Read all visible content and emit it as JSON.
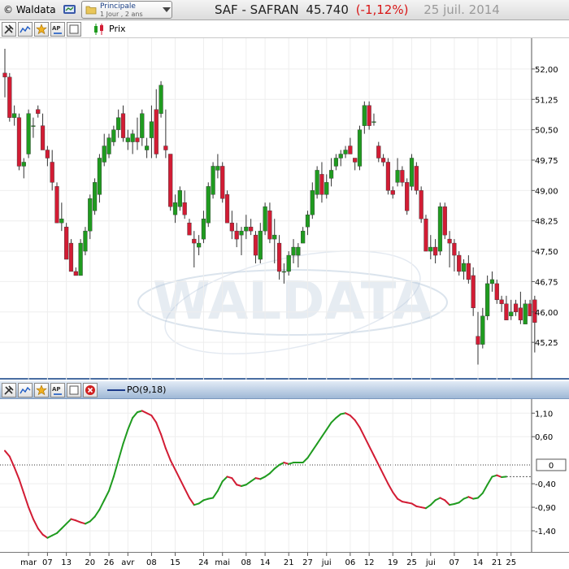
{
  "window": {
    "app_name": "© Waldata",
    "layout": {
      "name": "Principale",
      "period": "1 Jour , 2 ans"
    },
    "symbol": {
      "ticker": "SAF - SAFRAN",
      "price": "45.740",
      "change": "(-1,12%)",
      "date": "25 juil. 2014"
    }
  },
  "price_panel": {
    "legend": "Prix"
  },
  "osc_panel": {
    "legend": "PO(9,18)",
    "current_value_label": "0"
  },
  "icons": {
    "toolbar": [
      "tools-icon",
      "line-chart-icon",
      "star-tools-icon",
      "text-annotation-icon",
      "blank-square-icon",
      "close-icon"
    ],
    "title": [
      "layout-icon",
      "folder-icon",
      "chevron-down-icon"
    ]
  },
  "colors": {
    "up": "#1f9b1f",
    "down": "#d21c34",
    "watermark": "#b8c9dc",
    "panel_border": "#4a6ea2"
  },
  "chart_data": [
    {
      "type": "candlestick",
      "title": "SAF - SAFRAN",
      "legend": "Prix",
      "ylim": [
        44.45,
        52.6
      ],
      "yticks": [
        "52,00",
        "51,25",
        "50,50",
        "49,75",
        "49,00",
        "48,25",
        "47,50",
        "46,75",
        "46,00",
        "45,25"
      ],
      "x_labels": [
        "mar",
        "07",
        "13",
        "20",
        "26",
        "avr",
        "08",
        "15",
        "24",
        "mai",
        "08",
        "14",
        "21",
        "27",
        "jui",
        "06",
        "12",
        "19",
        "25",
        "jui",
        "07",
        "14",
        "21",
        "25"
      ],
      "x_label_index": [
        5,
        9,
        13,
        18,
        22,
        26,
        31,
        36,
        42,
        46,
        51,
        55,
        60,
        64,
        68,
        73,
        77,
        82,
        86,
        90,
        95,
        100,
        104,
        107
      ],
      "candles": [
        {
          "o": 51.9,
          "h": 52.5,
          "l": 51.3,
          "c": 51.8
        },
        {
          "o": 51.8,
          "h": 51.9,
          "l": 50.7,
          "c": 50.8
        },
        {
          "o": 50.8,
          "h": 51.1,
          "l": 50.6,
          "c": 50.9
        },
        {
          "o": 50.8,
          "h": 50.9,
          "l": 49.5,
          "c": 49.6
        },
        {
          "o": 49.6,
          "h": 49.8,
          "l": 49.3,
          "c": 49.7
        },
        {
          "o": 49.9,
          "h": 51.0,
          "l": 49.8,
          "c": 50.9
        },
        {
          "o": 50.6,
          "h": 50.8,
          "l": 50.3,
          "c": 50.6
        },
        {
          "o": 51.0,
          "h": 51.1,
          "l": 50.8,
          "c": 50.9
        },
        {
          "o": 50.6,
          "h": 50.9,
          "l": 50.0,
          "c": 50.0
        },
        {
          "o": 50.0,
          "h": 50.1,
          "l": 49.6,
          "c": 49.8
        },
        {
          "o": 49.7,
          "h": 50.0,
          "l": 49.0,
          "c": 49.2
        },
        {
          "o": 49.1,
          "h": 49.2,
          "l": 48.2,
          "c": 48.2
        },
        {
          "o": 48.2,
          "h": 48.7,
          "l": 48.0,
          "c": 48.3
        },
        {
          "o": 48.1,
          "h": 48.2,
          "l": 47.3,
          "c": 47.3
        },
        {
          "o": 47.7,
          "h": 47.8,
          "l": 47.0,
          "c": 47.0
        },
        {
          "o": 47.0,
          "h": 47.1,
          "l": 46.9,
          "c": 46.9
        },
        {
          "o": 46.9,
          "h": 47.8,
          "l": 46.9,
          "c": 47.7
        },
        {
          "o": 47.5,
          "h": 48.1,
          "l": 47.4,
          "c": 48.0
        },
        {
          "o": 48.0,
          "h": 48.9,
          "l": 47.8,
          "c": 48.8
        },
        {
          "o": 48.5,
          "h": 49.3,
          "l": 48.4,
          "c": 49.2
        },
        {
          "o": 48.9,
          "h": 49.9,
          "l": 48.7,
          "c": 49.8
        },
        {
          "o": 49.7,
          "h": 50.4,
          "l": 49.6,
          "c": 50.1
        },
        {
          "o": 49.9,
          "h": 50.4,
          "l": 49.8,
          "c": 50.3
        },
        {
          "o": 50.2,
          "h": 50.6,
          "l": 50.1,
          "c": 50.5
        },
        {
          "o": 50.5,
          "h": 51.0,
          "l": 50.3,
          "c": 50.8
        },
        {
          "o": 50.9,
          "h": 51.1,
          "l": 50.2,
          "c": 50.3
        },
        {
          "o": 50.2,
          "h": 50.5,
          "l": 50.0,
          "c": 50.3
        },
        {
          "o": 50.2,
          "h": 50.5,
          "l": 49.9,
          "c": 50.4
        },
        {
          "o": 50.3,
          "h": 50.8,
          "l": 50.0,
          "c": 50.2
        },
        {
          "o": 50.3,
          "h": 51.0,
          "l": 50.1,
          "c": 50.9
        },
        {
          "o": 50.0,
          "h": 50.3,
          "l": 49.8,
          "c": 50.1
        },
        {
          "o": 50.3,
          "h": 51.1,
          "l": 49.8,
          "c": 50.7
        },
        {
          "o": 51.0,
          "h": 51.5,
          "l": 49.8,
          "c": 49.9
        },
        {
          "o": 50.9,
          "h": 51.7,
          "l": 50.8,
          "c": 51.6
        },
        {
          "o": 50.1,
          "h": 51.0,
          "l": 49.8,
          "c": 50.0
        },
        {
          "o": 49.9,
          "h": 49.9,
          "l": 48.5,
          "c": 48.6
        },
        {
          "o": 48.4,
          "h": 48.9,
          "l": 48.2,
          "c": 48.7
        },
        {
          "o": 48.6,
          "h": 49.1,
          "l": 48.5,
          "c": 49.0
        },
        {
          "o": 48.7,
          "h": 49.0,
          "l": 48.3,
          "c": 48.4
        },
        {
          "o": 48.2,
          "h": 48.3,
          "l": 47.9,
          "c": 47.9
        },
        {
          "o": 47.8,
          "h": 48.0,
          "l": 47.1,
          "c": 47.7
        },
        {
          "o": 47.6,
          "h": 47.9,
          "l": 47.4,
          "c": 47.7
        },
        {
          "o": 47.8,
          "h": 48.5,
          "l": 47.7,
          "c": 48.3
        },
        {
          "o": 48.2,
          "h": 49.2,
          "l": 48.1,
          "c": 49.1
        },
        {
          "o": 48.9,
          "h": 49.7,
          "l": 48.8,
          "c": 49.6
        },
        {
          "o": 49.5,
          "h": 49.9,
          "l": 49.3,
          "c": 49.6
        },
        {
          "o": 49.6,
          "h": 49.7,
          "l": 48.7,
          "c": 48.8
        },
        {
          "o": 48.9,
          "h": 49.0,
          "l": 48.2,
          "c": 48.2
        },
        {
          "o": 48.2,
          "h": 48.5,
          "l": 47.8,
          "c": 48.0
        },
        {
          "o": 48.0,
          "h": 48.2,
          "l": 47.6,
          "c": 47.8
        },
        {
          "o": 47.9,
          "h": 48.1,
          "l": 47.4,
          "c": 48.0
        },
        {
          "o": 48.0,
          "h": 48.4,
          "l": 47.8,
          "c": 48.1
        },
        {
          "o": 48.1,
          "h": 48.3,
          "l": 47.9,
          "c": 48.0
        },
        {
          "o": 47.9,
          "h": 48.0,
          "l": 47.2,
          "c": 47.4
        },
        {
          "o": 47.3,
          "h": 48.2,
          "l": 47.2,
          "c": 48.0
        },
        {
          "o": 48.0,
          "h": 48.7,
          "l": 47.9,
          "c": 48.6
        },
        {
          "o": 48.5,
          "h": 48.7,
          "l": 47.7,
          "c": 47.8
        },
        {
          "o": 47.8,
          "h": 48.3,
          "l": 47.2,
          "c": 47.9
        },
        {
          "o": 47.7,
          "h": 47.9,
          "l": 46.8,
          "c": 47.0
        },
        {
          "o": 47.0,
          "h": 47.2,
          "l": 46.7,
          "c": 47.0
        },
        {
          "o": 47.0,
          "h": 47.5,
          "l": 46.9,
          "c": 47.4
        },
        {
          "o": 47.4,
          "h": 47.8,
          "l": 47.2,
          "c": 47.6
        },
        {
          "o": 47.4,
          "h": 47.7,
          "l": 47.1,
          "c": 47.6
        },
        {
          "o": 47.7,
          "h": 48.1,
          "l": 47.7,
          "c": 48.0
        },
        {
          "o": 48.1,
          "h": 48.5,
          "l": 47.9,
          "c": 48.4
        },
        {
          "o": 48.4,
          "h": 49.2,
          "l": 48.3,
          "c": 49.0
        },
        {
          "o": 48.9,
          "h": 49.6,
          "l": 48.8,
          "c": 49.5
        },
        {
          "o": 49.4,
          "h": 49.7,
          "l": 48.7,
          "c": 48.9
        },
        {
          "o": 48.9,
          "h": 49.4,
          "l": 48.8,
          "c": 49.2
        },
        {
          "o": 49.3,
          "h": 49.8,
          "l": 49.1,
          "c": 49.5
        },
        {
          "o": 49.6,
          "h": 49.9,
          "l": 49.5,
          "c": 49.8
        },
        {
          "o": 49.8,
          "h": 50.0,
          "l": 49.6,
          "c": 49.9
        },
        {
          "o": 49.9,
          "h": 50.1,
          "l": 49.8,
          "c": 50.0
        },
        {
          "o": 50.1,
          "h": 50.3,
          "l": 49.9,
          "c": 49.9
        },
        {
          "o": 49.8,
          "h": 49.8,
          "l": 49.5,
          "c": 49.7
        },
        {
          "o": 49.6,
          "h": 50.6,
          "l": 49.5,
          "c": 50.5
        },
        {
          "o": 50.6,
          "h": 51.2,
          "l": 50.4,
          "c": 51.1
        },
        {
          "o": 51.1,
          "h": 51.2,
          "l": 50.5,
          "c": 50.6
        },
        {
          "o": 50.7,
          "h": 50.9,
          "l": 50.6,
          "c": 50.7
        },
        {
          "o": 50.1,
          "h": 50.2,
          "l": 49.7,
          "c": 49.8
        },
        {
          "o": 49.8,
          "h": 49.9,
          "l": 49.6,
          "c": 49.7
        },
        {
          "o": 49.7,
          "h": 49.8,
          "l": 48.9,
          "c": 49.0
        },
        {
          "o": 49.0,
          "h": 49.1,
          "l": 48.8,
          "c": 48.9
        },
        {
          "o": 49.2,
          "h": 49.8,
          "l": 49.1,
          "c": 49.5
        },
        {
          "o": 49.5,
          "h": 49.6,
          "l": 49.1,
          "c": 49.2
        },
        {
          "o": 49.2,
          "h": 49.3,
          "l": 48.4,
          "c": 48.5
        },
        {
          "o": 49.1,
          "h": 49.9,
          "l": 49.0,
          "c": 49.8
        },
        {
          "o": 49.6,
          "h": 49.7,
          "l": 48.9,
          "c": 49.0
        },
        {
          "o": 49.0,
          "h": 49.1,
          "l": 48.2,
          "c": 48.3
        },
        {
          "o": 48.3,
          "h": 48.4,
          "l": 47.5,
          "c": 47.5
        },
        {
          "o": 47.5,
          "h": 47.9,
          "l": 47.3,
          "c": 47.6
        },
        {
          "o": 47.6,
          "h": 47.8,
          "l": 47.2,
          "c": 47.4
        },
        {
          "o": 47.5,
          "h": 48.7,
          "l": 47.4,
          "c": 48.6
        },
        {
          "o": 48.6,
          "h": 48.7,
          "l": 47.8,
          "c": 47.9
        },
        {
          "o": 47.8,
          "h": 48.0,
          "l": 47.1,
          "c": 47.7
        },
        {
          "o": 47.7,
          "h": 47.8,
          "l": 47.0,
          "c": 47.4
        },
        {
          "o": 47.4,
          "h": 47.5,
          "l": 46.9,
          "c": 47.0
        },
        {
          "o": 47.0,
          "h": 47.3,
          "l": 46.8,
          "c": 47.2
        },
        {
          "o": 47.2,
          "h": 47.4,
          "l": 46.7,
          "c": 46.8
        },
        {
          "o": 46.9,
          "h": 47.1,
          "l": 45.9,
          "c": 46.1
        },
        {
          "o": 45.4,
          "h": 46.0,
          "l": 44.7,
          "c": 45.2
        },
        {
          "o": 45.2,
          "h": 46.1,
          "l": 45.1,
          "c": 45.9
        },
        {
          "o": 45.9,
          "h": 46.9,
          "l": 45.8,
          "c": 46.7
        },
        {
          "o": 46.7,
          "h": 47.0,
          "l": 46.5,
          "c": 46.8
        },
        {
          "o": 46.7,
          "h": 46.8,
          "l": 46.2,
          "c": 46.3
        },
        {
          "o": 46.3,
          "h": 46.4,
          "l": 46.0,
          "c": 46.2
        },
        {
          "o": 46.2,
          "h": 46.4,
          "l": 45.8,
          "c": 45.8
        },
        {
          "o": 45.9,
          "h": 46.3,
          "l": 45.8,
          "c": 46.0
        },
        {
          "o": 46.2,
          "h": 46.3,
          "l": 45.9,
          "c": 46.0
        },
        {
          "o": 46.1,
          "h": 46.5,
          "l": 45.7,
          "c": 45.8
        },
        {
          "o": 45.7,
          "h": 46.3,
          "l": 45.7,
          "c": 46.2
        },
        {
          "o": 46.2,
          "h": 46.3,
          "l": 45.9,
          "c": 45.9
        },
        {
          "o": 46.3,
          "h": 46.4,
          "l": 45.0,
          "c": 45.74
        }
      ]
    },
    {
      "type": "line",
      "legend": "PO(9,18)",
      "ylim": [
        -1.78,
        1.26
      ],
      "yticks": [
        "1,10",
        "0,60",
        "0",
        "-0,40",
        "-0,90",
        "-1,40"
      ],
      "zero_line": 0,
      "current_value": -0.25,
      "values": [
        0.3,
        0.18,
        -0.05,
        -0.3,
        -0.6,
        -0.9,
        -1.15,
        -1.35,
        -1.48,
        -1.55,
        -1.5,
        -1.45,
        -1.35,
        -1.25,
        -1.15,
        -1.18,
        -1.22,
        -1.25,
        -1.2,
        -1.1,
        -0.95,
        -0.75,
        -0.55,
        -0.25,
        0.1,
        0.45,
        0.75,
        1.0,
        1.12,
        1.15,
        1.1,
        1.05,
        0.9,
        0.65,
        0.35,
        0.1,
        -0.1,
        -0.3,
        -0.5,
        -0.7,
        -0.85,
        -0.82,
        -0.75,
        -0.72,
        -0.7,
        -0.55,
        -0.35,
        -0.25,
        -0.28,
        -0.42,
        -0.45,
        -0.42,
        -0.35,
        -0.28,
        -0.3,
        -0.25,
        -0.18,
        -0.08,
        0.0,
        0.05,
        0.02,
        0.05,
        0.05,
        0.05,
        0.15,
        0.3,
        0.45,
        0.6,
        0.75,
        0.9,
        1.0,
        1.08,
        1.1,
        1.05,
        0.95,
        0.8,
        0.6,
        0.4,
        0.2,
        0.0,
        -0.2,
        -0.4,
        -0.58,
        -0.72,
        -0.78,
        -0.8,
        -0.82,
        -0.88,
        -0.9,
        -0.92,
        -0.85,
        -0.75,
        -0.7,
        -0.75,
        -0.85,
        -0.83,
        -0.8,
        -0.72,
        -0.68,
        -0.72,
        -0.7,
        -0.6,
        -0.42,
        -0.25,
        -0.22,
        -0.26,
        -0.25
      ]
    }
  ]
}
